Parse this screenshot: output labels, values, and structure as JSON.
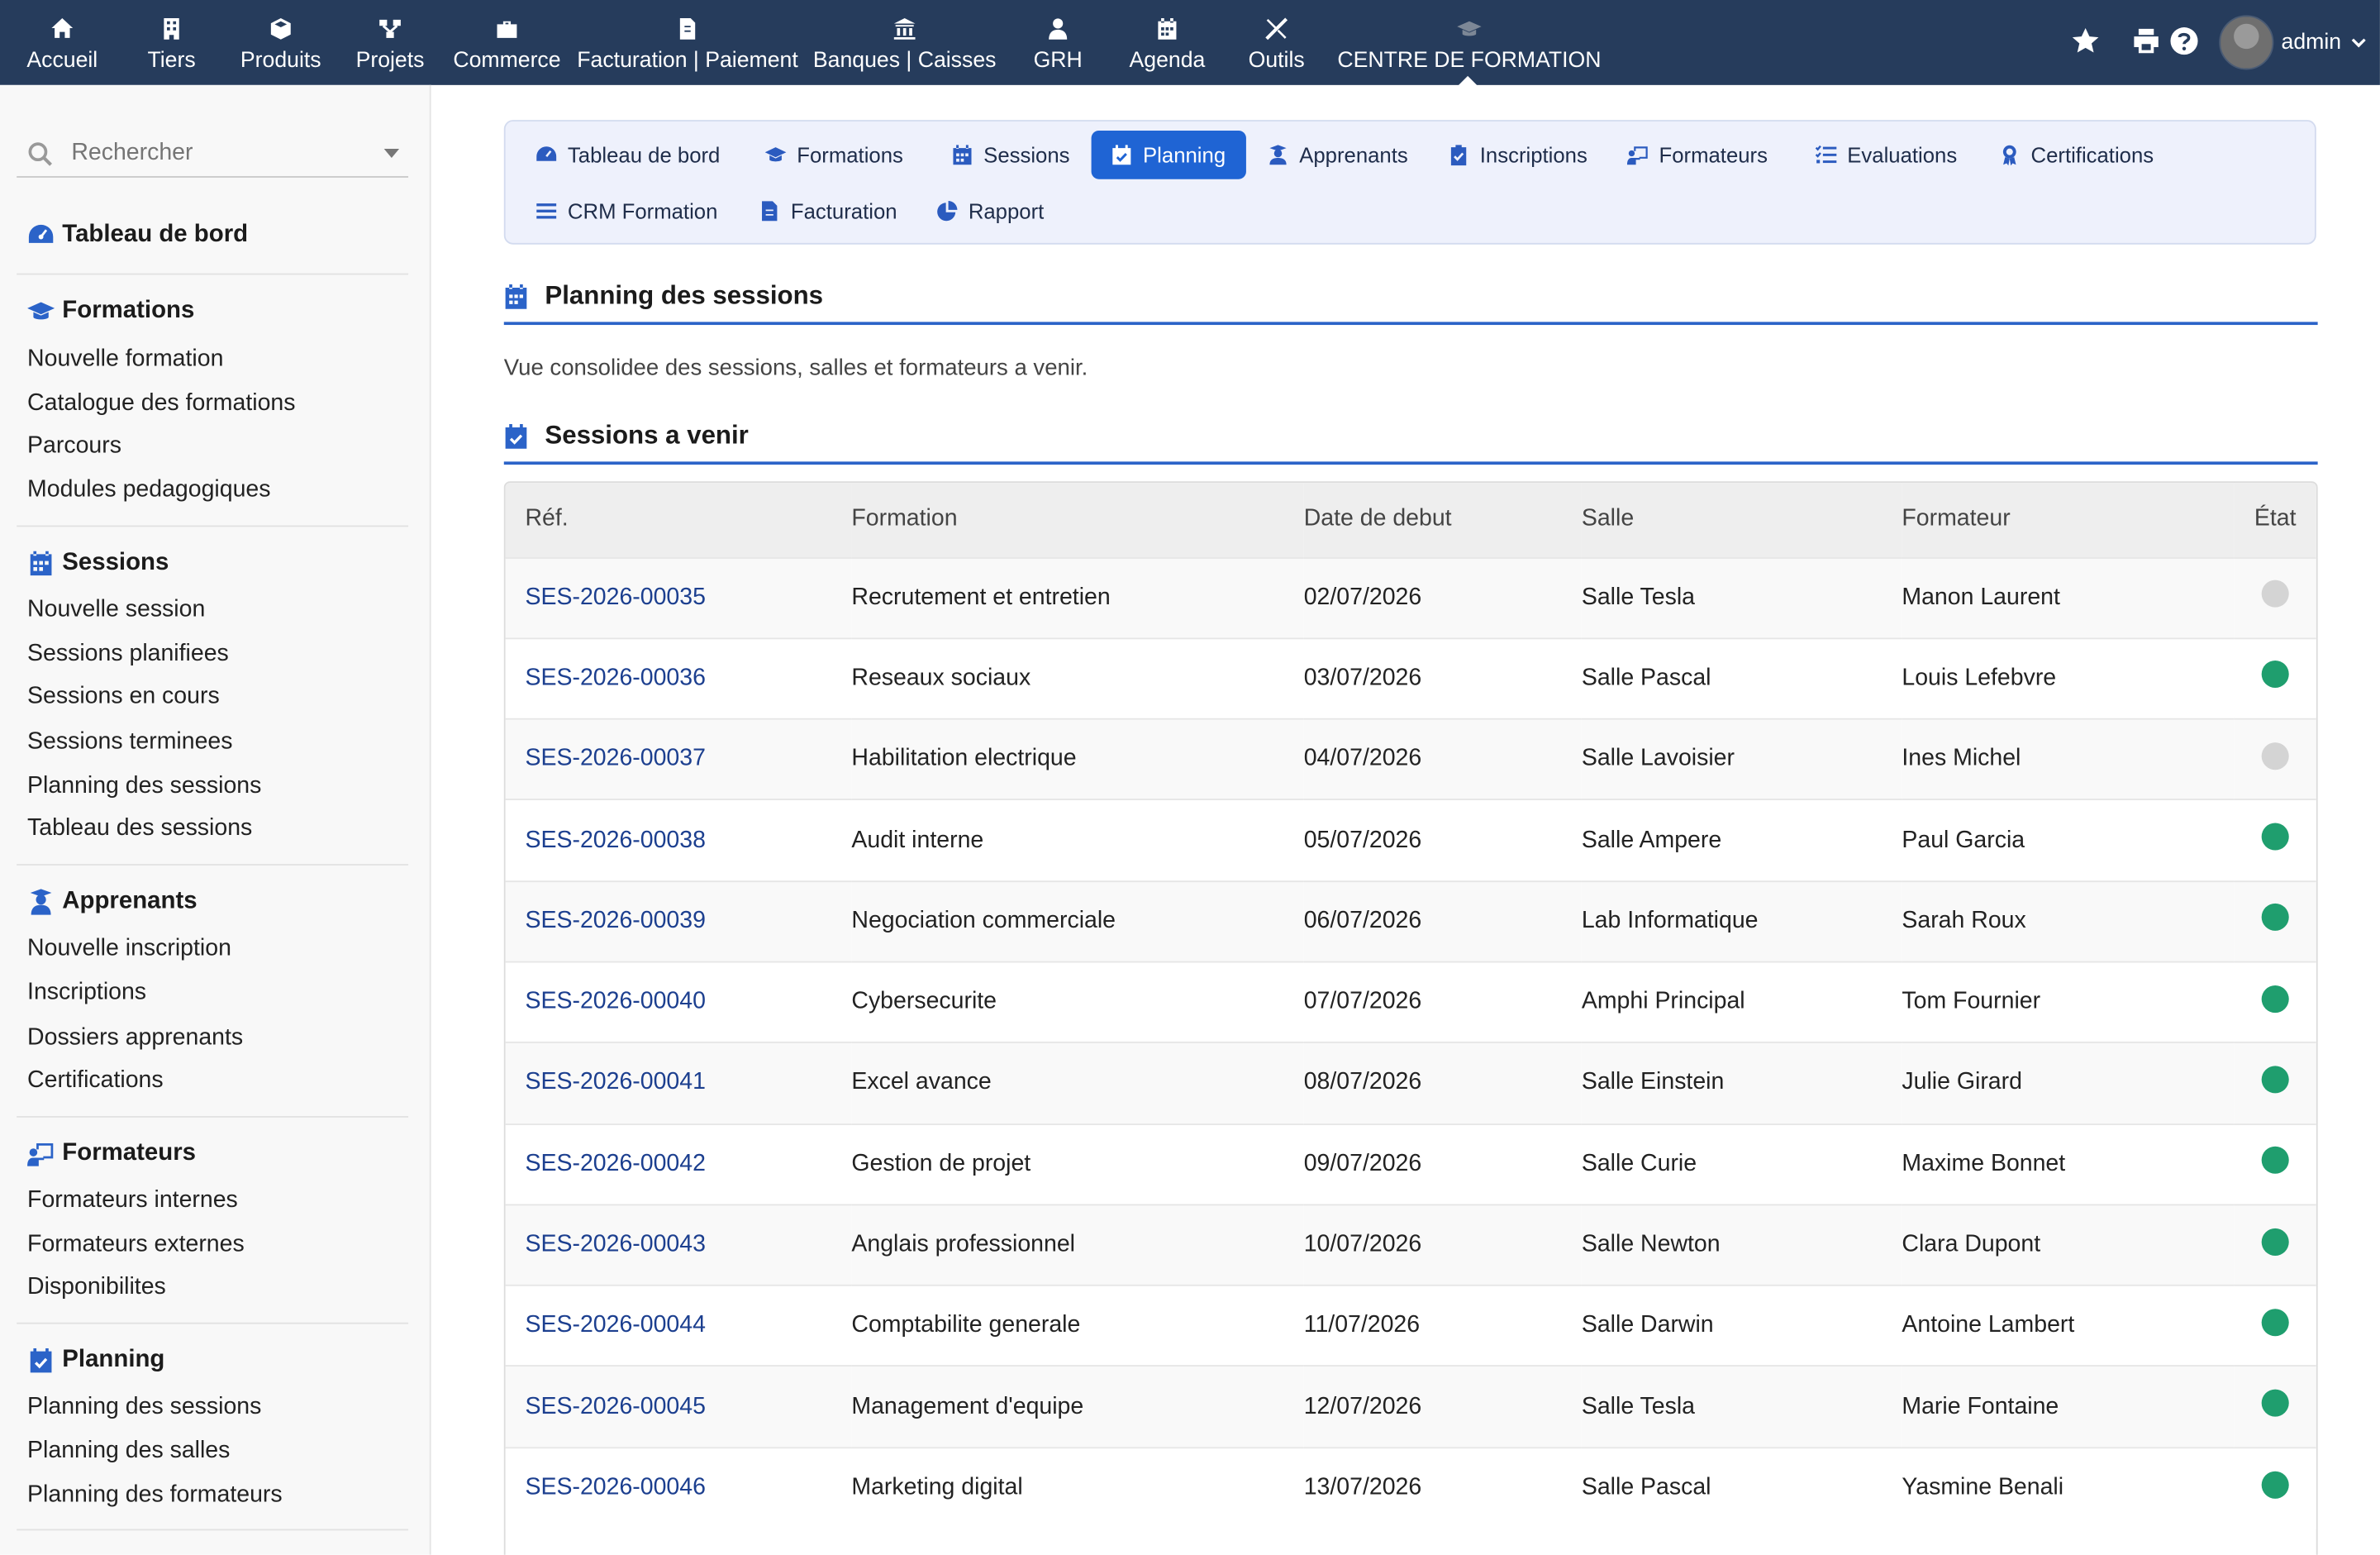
{
  "topbar": {
    "menu": [
      {
        "label": "Accueil",
        "icon": "home-icon"
      },
      {
        "label": "Tiers",
        "icon": "building-icon"
      },
      {
        "label": "Produits",
        "icon": "cube-icon"
      },
      {
        "label": "Projets",
        "icon": "project-icon"
      },
      {
        "label": "Commerce",
        "icon": "briefcase-icon"
      },
      {
        "label": "Facturation | Paiement",
        "icon": "invoice-icon"
      },
      {
        "label": "Banques | Caisses",
        "icon": "bank-icon"
      },
      {
        "label": "GRH",
        "icon": "user-tie-icon"
      },
      {
        "label": "Agenda",
        "icon": "calendar-icon"
      },
      {
        "label": "Outils",
        "icon": "tools-icon"
      },
      {
        "label": "CENTRE DE FORMATION",
        "icon": "graduation-cap-icon"
      }
    ],
    "user": "admin"
  },
  "sidebar": {
    "search_placeholder": "Rechercher",
    "dashboard": "Tableau de bord",
    "sections": [
      {
        "title": "Formations",
        "links": [
          "Nouvelle formation",
          "Catalogue des formations",
          "Parcours",
          "Modules pedagogiques"
        ]
      },
      {
        "title": "Sessions",
        "links": [
          "Nouvelle session",
          "Sessions planifiees",
          "Sessions en cours",
          "Sessions terminees",
          "Planning des sessions",
          "Tableau des sessions"
        ]
      },
      {
        "title": "Apprenants",
        "links": [
          "Nouvelle inscription",
          "Inscriptions",
          "Dossiers apprenants",
          "Certifications"
        ]
      },
      {
        "title": "Formateurs",
        "links": [
          "Formateurs internes",
          "Formateurs externes",
          "Disponibilites"
        ]
      },
      {
        "title": "Planning",
        "links": [
          "Planning des sessions",
          "Planning des salles",
          "Planning des formateurs"
        ]
      }
    ]
  },
  "tabs": {
    "row1": [
      "Tableau de bord",
      "Formations",
      "Sessions",
      "Planning",
      "Apprenants",
      "Inscriptions",
      "Formateurs",
      "Evaluations",
      "Certifications"
    ],
    "row2": [
      "CRM Formation",
      "Facturation",
      "Rapport"
    ],
    "active": "Planning"
  },
  "page": {
    "title": "Planning des sessions",
    "subtitle": "Vue consolidee des sessions, salles et formateurs a venir.",
    "section": "Sessions a venir"
  },
  "table": {
    "headers": [
      "Réf.",
      "Formation",
      "Date de debut",
      "Salle",
      "Formateur",
      "État"
    ],
    "rows": [
      {
        "ref": "SES-2026-00035",
        "formation": "Recrutement et entretien",
        "date": "02/07/2026",
        "salle": "Salle Tesla",
        "formateur": "Manon Laurent",
        "etat": "draft"
      },
      {
        "ref": "SES-2026-00036",
        "formation": "Reseaux sociaux",
        "date": "03/07/2026",
        "salle": "Salle Pascal",
        "formateur": "Louis Lefebvre",
        "etat": "validated"
      },
      {
        "ref": "SES-2026-00037",
        "formation": "Habilitation electrique",
        "date": "04/07/2026",
        "salle": "Salle Lavoisier",
        "formateur": "Ines Michel",
        "etat": "draft"
      },
      {
        "ref": "SES-2026-00038",
        "formation": "Audit interne",
        "date": "05/07/2026",
        "salle": "Salle Ampere",
        "formateur": "Paul Garcia",
        "etat": "validated"
      },
      {
        "ref": "SES-2026-00039",
        "formation": "Negociation commerciale",
        "date": "06/07/2026",
        "salle": "Lab Informatique",
        "formateur": "Sarah Roux",
        "etat": "validated"
      },
      {
        "ref": "SES-2026-00040",
        "formation": "Cybersecurite",
        "date": "07/07/2026",
        "salle": "Amphi Principal",
        "formateur": "Tom Fournier",
        "etat": "validated"
      },
      {
        "ref": "SES-2026-00041",
        "formation": "Excel avance",
        "date": "08/07/2026",
        "salle": "Salle Einstein",
        "formateur": "Julie Girard",
        "etat": "validated"
      },
      {
        "ref": "SES-2026-00042",
        "formation": "Gestion de projet",
        "date": "09/07/2026",
        "salle": "Salle Curie",
        "formateur": "Maxime Bonnet",
        "etat": "validated"
      },
      {
        "ref": "SES-2026-00043",
        "formation": "Anglais professionnel",
        "date": "10/07/2026",
        "salle": "Salle Newton",
        "formateur": "Clara Dupont",
        "etat": "validated"
      },
      {
        "ref": "SES-2026-00044",
        "formation": "Comptabilite generale",
        "date": "11/07/2026",
        "salle": "Salle Darwin",
        "formateur": "Antoine Lambert",
        "etat": "validated"
      },
      {
        "ref": "SES-2026-00045",
        "formation": "Management d'equipe",
        "date": "12/07/2026",
        "salle": "Salle Tesla",
        "formateur": "Marie Fontaine",
        "etat": "validated"
      },
      {
        "ref": "SES-2026-00046",
        "formation": "Marketing digital",
        "date": "13/07/2026",
        "salle": "Salle Pascal",
        "formateur": "Yasmine Benali",
        "etat": "validated"
      }
    ]
  },
  "colors": {
    "topbar_bg": "#263c5c",
    "accent": "#1f64d4",
    "status_validated": "#1f9e6e",
    "status_draft": "#d4d4d4"
  }
}
